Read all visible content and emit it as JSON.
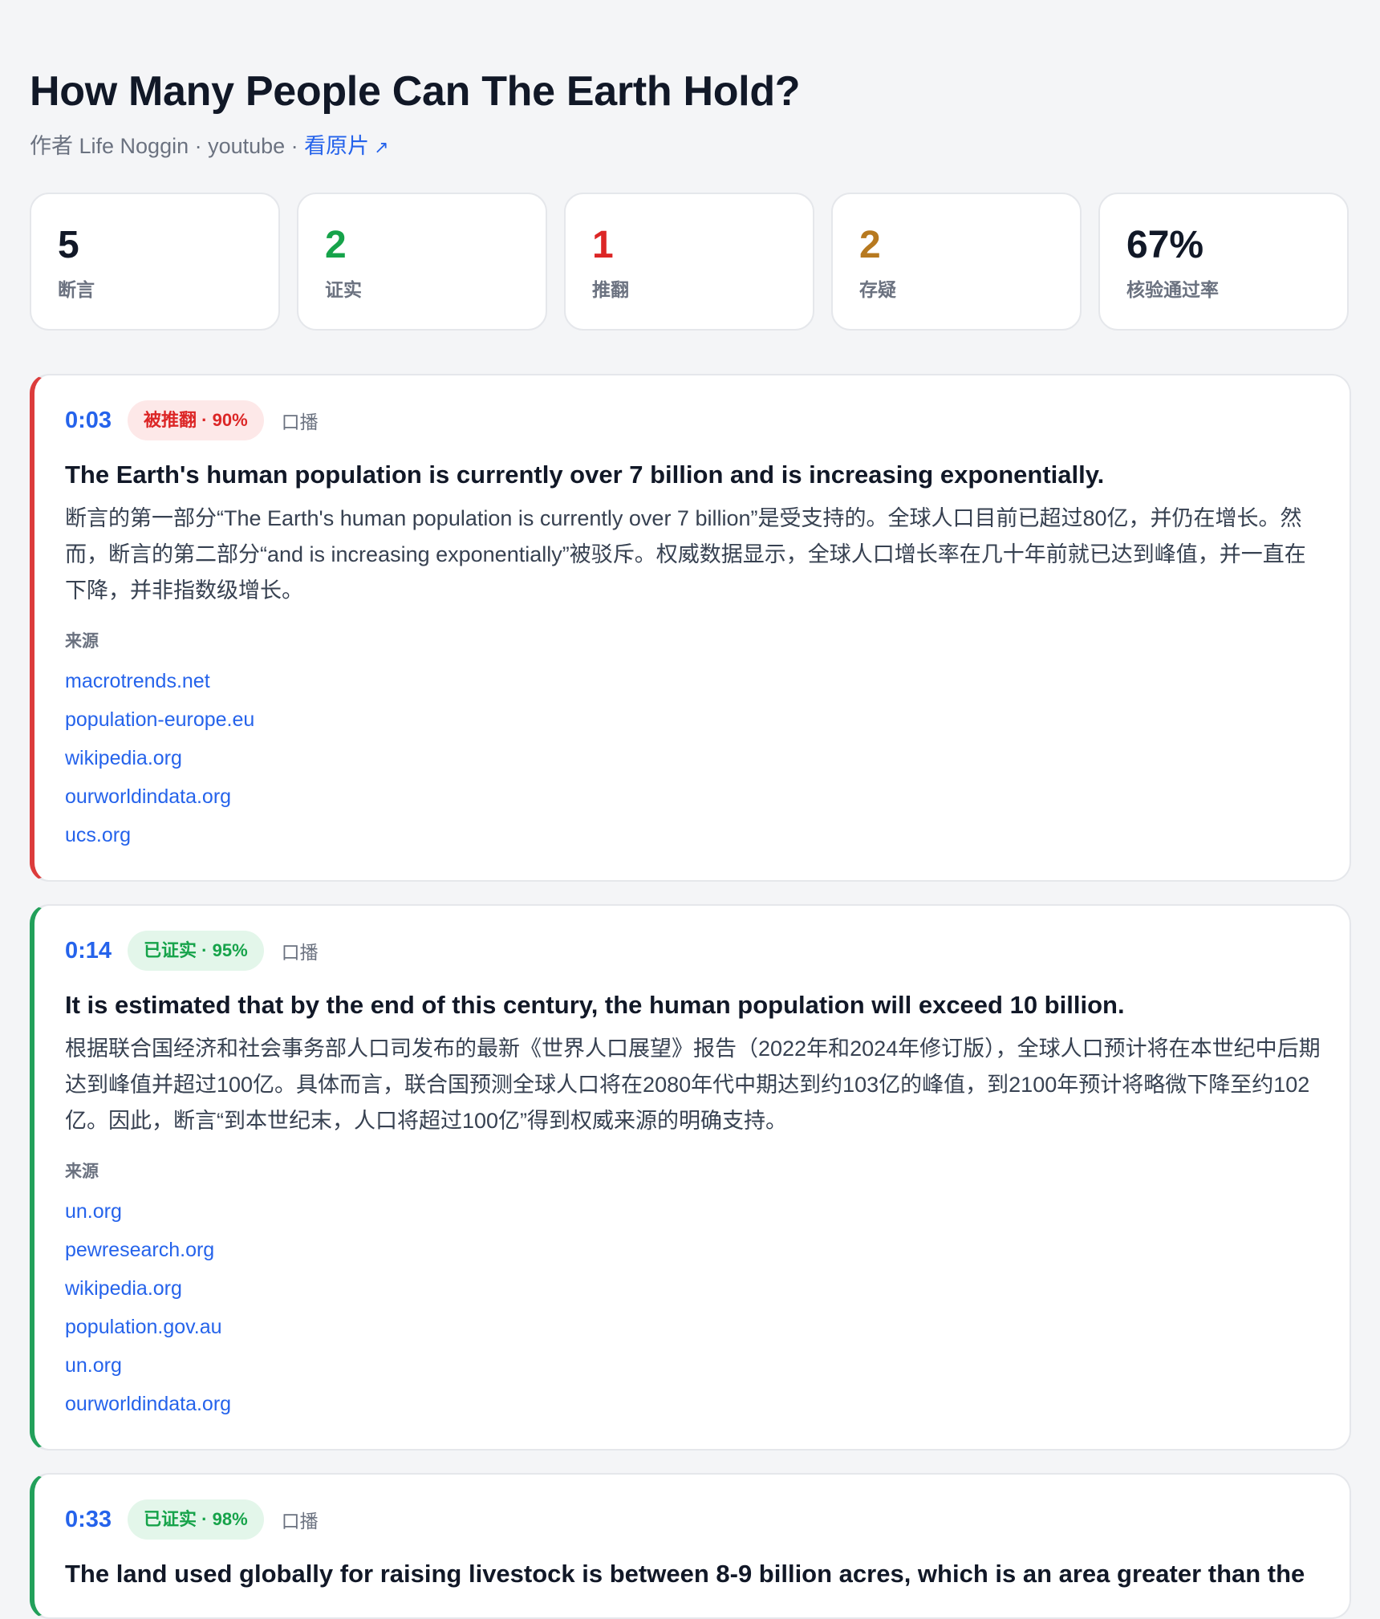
{
  "page": {
    "title": "How Many People Can The Earth Hold?",
    "meta_text": "作者 Life Noggin · youtube · ",
    "watch_link": "看原片",
    "external_icon": "↗"
  },
  "stats": [
    {
      "value": "5",
      "label": "断言",
      "color": "#111827"
    },
    {
      "value": "2",
      "label": "证实",
      "color": "#16a34a"
    },
    {
      "value": "1",
      "label": "推翻",
      "color": "#dc2626"
    },
    {
      "value": "2",
      "label": "存疑",
      "color": "#b7791f"
    },
    {
      "value": "67%",
      "label": "核验通过率",
      "color": "#111827"
    }
  ],
  "sources_label": "来源",
  "claims": [
    {
      "timestamp": "0:03",
      "verdict": "被推翻 · 90%",
      "verdict_type": "refuted",
      "accent_color": "#dc3c3c",
      "badge_bg": "#fde8e8",
      "badge_fg": "#dc2626",
      "mode": "口播",
      "text": "The Earth's human population is currently over 7 billion and is increasing exponentially.",
      "explanation": "断言的第一部分“The Earth's human population is currently over 7 billion”是受支持的。全球人口目前已超过80亿，并仍在增长。然而，断言的第二部分“and is increasing exponentially”被驳斥。权威数据显示，全球人口增长率在几十年前就已达到峰值，并一直在下降，并非指数级增长。",
      "sources": [
        "macrotrends.net",
        "population-europe.eu",
        "wikipedia.org",
        "ourworldindata.org",
        "ucs.org"
      ]
    },
    {
      "timestamp": "0:14",
      "verdict": "已证实 · 95%",
      "verdict_type": "confirmed",
      "accent_color": "#22a05a",
      "badge_bg": "#e3f6ea",
      "badge_fg": "#16a34a",
      "mode": "口播",
      "text": "It is estimated that by the end of this century, the human population will exceed 10 billion.",
      "explanation": "根据联合国经济和社会事务部人口司发布的最新《世界人口展望》报告（2022年和2024年修订版），全球人口预计将在本世纪中后期达到峰值并超过100亿。具体而言，联合国预测全球人口将在2080年代中期达到约103亿的峰值，到2100年预计将略微下降至约102亿。因此，断言“到本世纪末，人口将超过100亿”得到权威来源的明确支持。",
      "sources": [
        "un.org",
        "pewresearch.org",
        "wikipedia.org",
        "population.gov.au",
        "un.org",
        "ourworldindata.org"
      ]
    },
    {
      "timestamp": "0:33",
      "verdict": "已证实 · 98%",
      "verdict_type": "confirmed",
      "accent_color": "#22a05a",
      "badge_bg": "#e3f6ea",
      "badge_fg": "#16a34a",
      "mode": "口播",
      "text": "The land used globally for raising livestock is between 8-9 billion acres, which is an area greater than the",
      "explanation": "",
      "sources": []
    }
  ]
}
